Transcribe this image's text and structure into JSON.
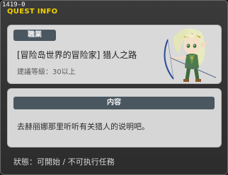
{
  "window": {
    "id_label": "1419-0",
    "title": "QUEST INFO"
  },
  "quest": {
    "job_label": "職業",
    "name": "[冒险岛世界的冒险家] 猎人之路",
    "recommended_level": "建議等級：30以上",
    "portrait": "elf-archer-portrait"
  },
  "content": {
    "header": "内容",
    "description": "去赫丽娜那里听听有关猎人的说明吧。"
  },
  "status": {
    "text": "狀態：可開始 / 不可执行任務"
  }
}
